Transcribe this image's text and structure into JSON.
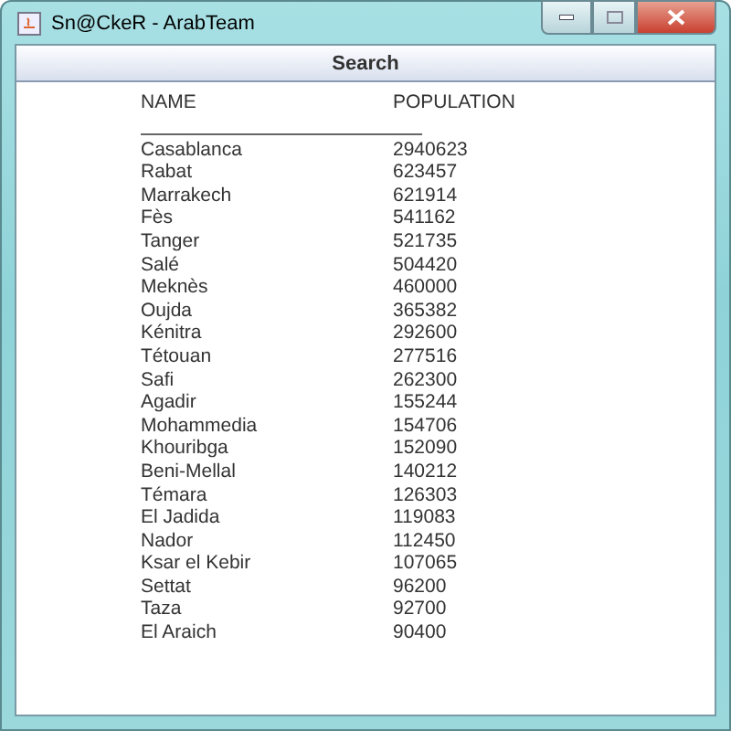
{
  "window": {
    "title": "Sn@CkeR - ArabTeam"
  },
  "search_button": {
    "label": "Search"
  },
  "table": {
    "columns": [
      "NAME",
      "POPULATION"
    ],
    "rows": [
      [
        "Casablanca",
        "2940623"
      ],
      [
        "Rabat",
        "623457"
      ],
      [
        "Marrakech",
        "621914"
      ],
      [
        "Fès",
        "541162"
      ],
      [
        "Tanger",
        "521735"
      ],
      [
        "Salé",
        "504420"
      ],
      [
        "Meknès",
        "460000"
      ],
      [
        "Oujda",
        "365382"
      ],
      [
        "Kénitra",
        "292600"
      ],
      [
        "Tétouan",
        "277516"
      ],
      [
        "Safi",
        "262300"
      ],
      [
        "Agadir",
        "155244"
      ],
      [
        "Mohammedia",
        "154706"
      ],
      [
        "Khouribga",
        "152090"
      ],
      [
        "Beni-Mellal",
        "140212"
      ],
      [
        "Témara",
        "126303"
      ],
      [
        "El Jadida",
        "119083"
      ],
      [
        "Nador",
        "112450"
      ],
      [
        "Ksar el Kebir",
        "107065"
      ],
      [
        "Settat",
        "96200"
      ],
      [
        "Taza",
        "92700"
      ],
      [
        "El Araich",
        "90400"
      ]
    ]
  }
}
